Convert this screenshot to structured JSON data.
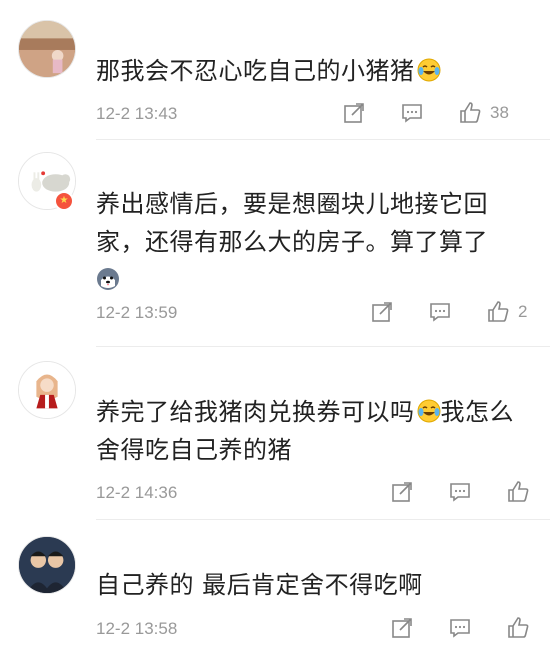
{
  "comments": [
    {
      "text": "那我会不忍心吃自己的小猪猪",
      "emoji": "laugh-cry-emoji",
      "time": "12-2 13:43",
      "likes": "38"
    },
    {
      "text": "养出感情后，要是想圈块儿地接它回家，还得有那么大的房子。算了算了",
      "emoji": "husky-dog-emoji",
      "time": "12-2 13:59",
      "likes": "2",
      "verified_badge": "star-badge-icon"
    },
    {
      "text": "养完了给我猪肉兑换券可以吗",
      "text2": "我怎么舍得吃自己养的猪",
      "emoji": "laugh-cry-emoji",
      "time": "12-2 14:36",
      "likes": ""
    },
    {
      "text": "自己养的 最后肯定舍不得吃啊",
      "time": "12-2 13:58",
      "likes": ""
    }
  ],
  "icons": {
    "repost": "repost-icon",
    "comment": "comment-icon",
    "like": "thumbs-up-icon"
  },
  "colors": {
    "text": "#222222",
    "meta": "#999999",
    "badge": "#f5533d"
  }
}
